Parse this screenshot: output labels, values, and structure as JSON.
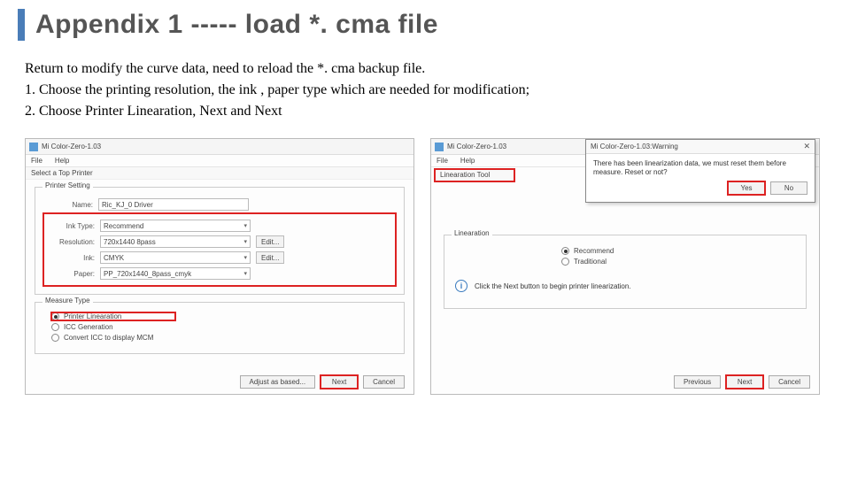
{
  "title": "Appendix 1 ----- load *. cma file",
  "body": {
    "intro": "Return to modify the curve data, need to reload the *. cma backup file.",
    "step1": "1. Choose the printing resolution, the ink , paper type which are needed for modification;",
    "step2": "2. Choose Printer Linearation, Next and Next"
  },
  "left": {
    "window_title": "Mi Color-Zero-1.03",
    "menu": {
      "file": "File",
      "help": "Help"
    },
    "section": "Select a Top Printer",
    "group_printer": "Printer Setting",
    "rows": {
      "name": {
        "label": "Name:",
        "value": "Ric_KJ_0 Driver"
      },
      "inktype": {
        "label": "Ink Type:",
        "value": "Recommend"
      },
      "resolution": {
        "label": "Resolution:",
        "value": "720x1440 8pass",
        "btn": "Edit..."
      },
      "ink": {
        "label": "Ink:",
        "value": "CMYK",
        "btn": "Edit..."
      },
      "paper": {
        "label": "Paper:",
        "value": "PP_720x1440_8pass_cmyk"
      }
    },
    "group_measure": "Measure Type",
    "options": {
      "linearation": "Printer Linearation",
      "icc": "ICC Generation",
      "convert": "Convert ICC to display MCM"
    },
    "buttons": {
      "adjust": "Adjust as based...",
      "next": "Next",
      "cancel": "Cancel"
    }
  },
  "right": {
    "window_title": "Mi Color-Zero-1.03",
    "menu": {
      "file": "File",
      "help": "Help"
    },
    "section": "Linearation Tool",
    "popup": {
      "title": "Mi Color-Zero-1.03:Warning",
      "msg": "There has been linearization data, we must reset them before measure. Reset or not?",
      "yes": "Yes",
      "no": "No"
    },
    "group_lin": "Linearation",
    "opts": {
      "recommend": "Recommend",
      "traditional": "Traditional"
    },
    "info": "Click the Next button to begin printer linearization.",
    "buttons": {
      "prev": "Previous",
      "next": "Next",
      "cancel": "Cancel"
    }
  }
}
